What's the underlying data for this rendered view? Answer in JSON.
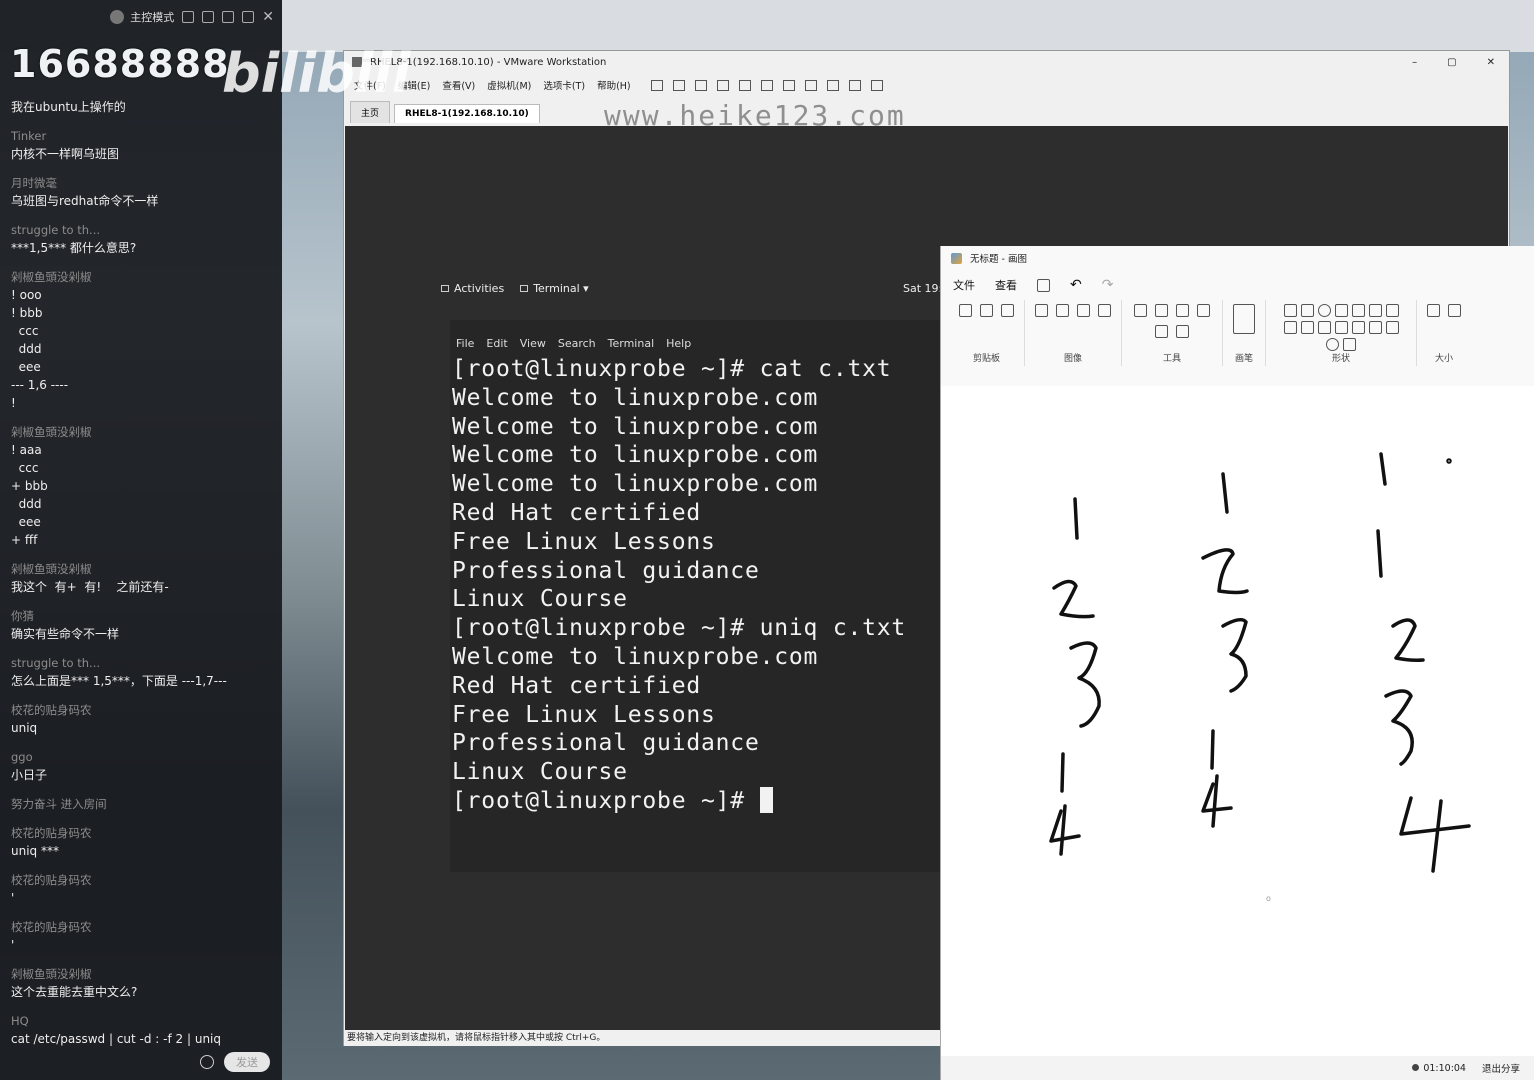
{
  "chat": {
    "mode_label": "主控模式",
    "watermark_number": "16688888",
    "watermark_logo": "bilibili",
    "messages": [
      {
        "user": "",
        "lines": [
          "我在ubuntu上操作的"
        ]
      },
      {
        "user": "Tinker",
        "lines": [
          "内核不一样啊乌班图"
        ]
      },
      {
        "user": "月时微毫",
        "lines": [
          "乌班图与redhat命令不一样"
        ]
      },
      {
        "user": "struggle to th...",
        "lines": [
          "***1,5*** 都什么意思?"
        ]
      },
      {
        "user": "剁椒鱼頭没剁椒",
        "lines": [
          "! ooo",
          "! bbb",
          "  ccc",
          "  ddd",
          "  eee",
          "--- 1,6 ----",
          "!"
        ]
      },
      {
        "user": "剁椒鱼頭没剁椒",
        "lines": [
          "! aaa",
          "  ccc",
          "+ bbb",
          "  ddd",
          "  eee",
          "+ fff"
        ]
      },
      {
        "user": "剁椒鱼頭没剁椒",
        "lines": [
          "我这个  有+  有!    之前还有-"
        ]
      },
      {
        "user": "你猜",
        "lines": [
          "确实有些命令不一样"
        ]
      },
      {
        "user": "struggle to th...",
        "lines": [
          "怎么上面是*** 1,5***，下面是 ---1,7---"
        ]
      },
      {
        "user": "校花的贴身码农",
        "lines": [
          "uniq"
        ]
      },
      {
        "user": "ggo",
        "lines": [
          "小日子"
        ]
      },
      {
        "user": "努力奋斗 进入房间",
        "lines": []
      },
      {
        "user": "校花的贴身码农",
        "lines": [
          "uniq ***"
        ]
      },
      {
        "user": "校花的贴身码农",
        "lines": [
          "'"
        ]
      },
      {
        "user": "校花的贴身码农",
        "lines": [
          "'"
        ]
      },
      {
        "user": "剁椒鱼頭没剁椒",
        "lines": [
          "这个去重能去重中文么?"
        ]
      },
      {
        "user": "HQ",
        "lines": [
          "cat /etc/passwd | cut -d : -f 2 | uniq"
        ]
      }
    ],
    "send_label": "发送"
  },
  "vmware": {
    "title": "RHEL8-1(192.168.10.10) - VMware Workstation",
    "controls": [
      "–",
      "▢",
      "✕"
    ],
    "menu": [
      "文件(F)",
      "编辑(E)",
      "查看(V)",
      "虚拟机(M)",
      "选项卡(T)",
      "帮助(H)"
    ],
    "tabs": [
      "主页",
      "RHEL8-1(192.168.10.10)"
    ],
    "site_watermark": "www.heike123.com",
    "status_text": "要将输入定向到该虚拟机，请将鼠标指针移入其中或按 Ctrl+G。"
  },
  "gnome": {
    "activities": "Activities",
    "app": "Terminal ▾",
    "clock": "Sat 19:"
  },
  "terminal": {
    "menu": [
      "File",
      "Edit",
      "View",
      "Search",
      "Terminal",
      "Help"
    ],
    "lines": [
      "[root@linuxprobe ~]# cat c.txt",
      "Welcome to linuxprobe.com",
      "Welcome to linuxprobe.com",
      "Welcome to linuxprobe.com",
      "Welcome to linuxprobe.com",
      "Red Hat certified",
      "Free Linux Lessons",
      "Professional guidance",
      "Linux Course",
      "[root@linuxprobe ~]# uniq c.txt",
      "Welcome to linuxprobe.com",
      "Red Hat certified",
      "Free Linux Lessons",
      "Professional guidance",
      "Linux Course"
    ],
    "prompt": "[root@linuxprobe ~]# "
  },
  "paint": {
    "title": "无标题 - 画图",
    "menu": [
      "文件",
      "查看"
    ],
    "groups": [
      "剪贴板",
      "图像",
      "工具",
      "画笔",
      "形状",
      "大小"
    ],
    "canvas_marker": "o",
    "rec_time": "01:10:04",
    "exit_share": "退出分享"
  }
}
